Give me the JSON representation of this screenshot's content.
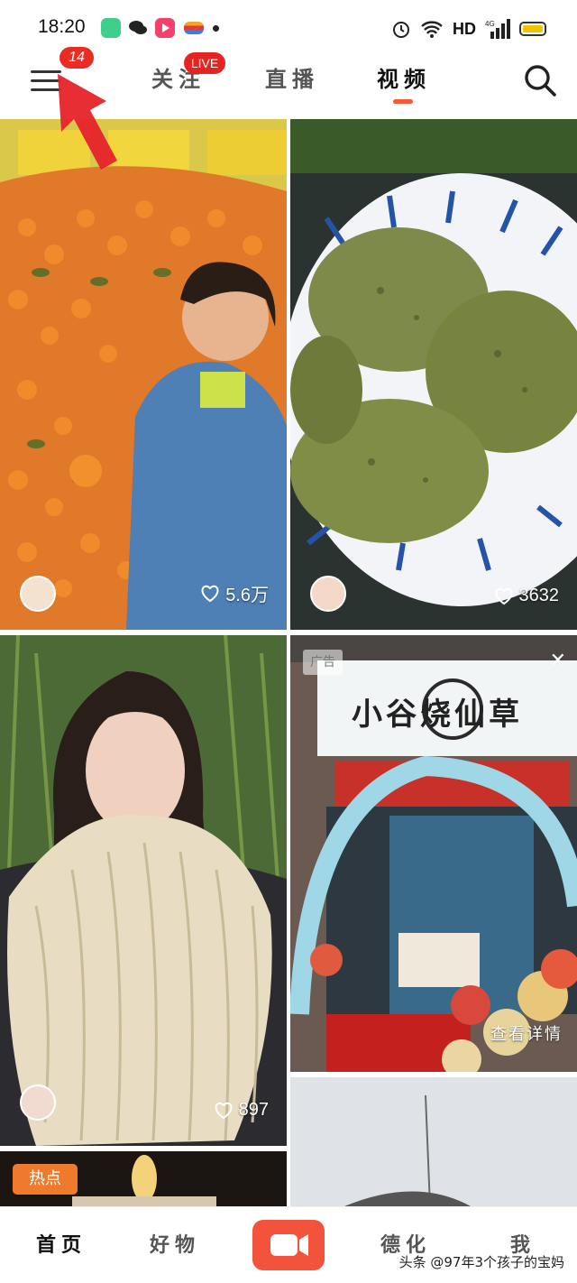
{
  "status_bar": {
    "time": "18:20",
    "network": "HD",
    "signal_label": "4G"
  },
  "top_nav": {
    "menu_badge": "14",
    "tabs": [
      {
        "label": "关注",
        "active": false
      },
      {
        "label": "直播",
        "active": false
      },
      {
        "label": "视频",
        "active": true
      }
    ],
    "live_badge": "LIVE"
  },
  "feed": [
    {
      "id": "card1",
      "likes": "5.6万",
      "subject": "oranges"
    },
    {
      "id": "card2",
      "likes": "3632",
      "subject": "green-cakes"
    },
    {
      "id": "card3",
      "likes": "897",
      "subject": "tripe"
    },
    {
      "id": "card4",
      "is_ad": true,
      "ad_label": "广告",
      "shop_sign": "小谷烧仙草",
      "detail_label": "查看详情"
    },
    {
      "id": "card5",
      "tag": "热点"
    }
  ],
  "bottom_nav": {
    "items": [
      {
        "label": "首页",
        "active": true
      },
      {
        "label": "好物",
        "active": false
      },
      {
        "label": "德化",
        "active": false
      },
      {
        "label": "我",
        "active": false
      }
    ],
    "watermark": "头条 @97年3个孩子的宝妈"
  },
  "colors": {
    "accent": "#f2533a",
    "badge": "#ea2c24",
    "hot_tag": "#f07a2c"
  }
}
